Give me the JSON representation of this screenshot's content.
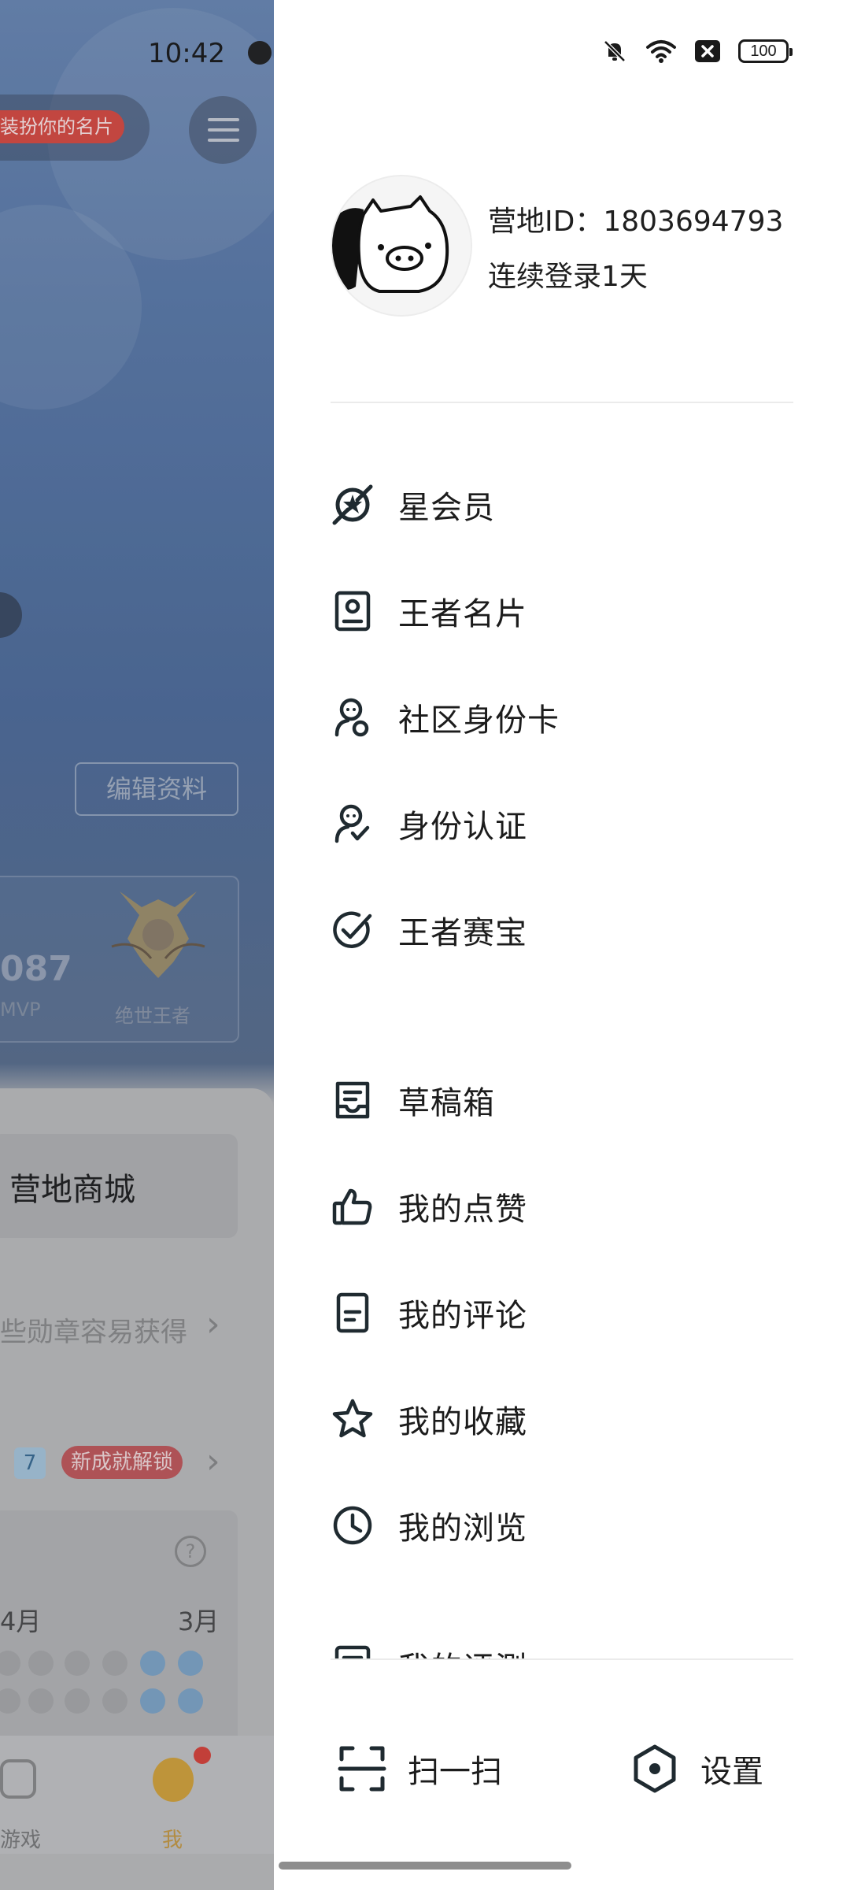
{
  "status_bar": {
    "time": "10:42",
    "battery": "100",
    "icons": [
      "bell-off-icon",
      "wifi-icon",
      "sim-x-icon",
      "battery-icon"
    ]
  },
  "background_app": {
    "name_card_tag": "装扮你的名片",
    "edit_profile": "编辑资料",
    "stat_value": "087",
    "stat_label": "MVP",
    "rank_label": "绝世王者",
    "shop": "营地商城",
    "medals_row": "些勋章容易获得",
    "badge_count": "7",
    "unlock_tag": "新成就解锁",
    "month_left": "4月",
    "month_right": "3月",
    "tab_game": "游戏",
    "tab_me": "我"
  },
  "drawer": {
    "profile": {
      "camp_id": "营地ID：1803694793",
      "streak": "连续登录1天"
    },
    "menu_primary": [
      {
        "label": "星会员",
        "icon": "star-member-icon"
      },
      {
        "label": "王者名片",
        "icon": "name-card-icon"
      },
      {
        "label": "社区身份卡",
        "icon": "community-id-icon"
      },
      {
        "label": "身份认证",
        "icon": "identity-verify-icon"
      },
      {
        "label": "王者赛宝",
        "icon": "tournament-check-icon"
      }
    ],
    "menu_secondary": [
      {
        "label": "草稿箱",
        "icon": "drafts-icon"
      },
      {
        "label": "我的点赞",
        "icon": "thumbs-up-icon"
      },
      {
        "label": "我的评论",
        "icon": "comment-doc-icon"
      },
      {
        "label": "我的收藏",
        "icon": "star-icon"
      },
      {
        "label": "我的浏览",
        "icon": "clock-icon"
      },
      {
        "label": "我的评測",
        "icon": "review-icon"
      }
    ],
    "bottom": {
      "scan": "扫一扫",
      "settings": "设置"
    }
  },
  "colors": {
    "icon_stroke": "#1f2a30",
    "text": "#1c1c1c",
    "divider": "#ebebeb"
  }
}
